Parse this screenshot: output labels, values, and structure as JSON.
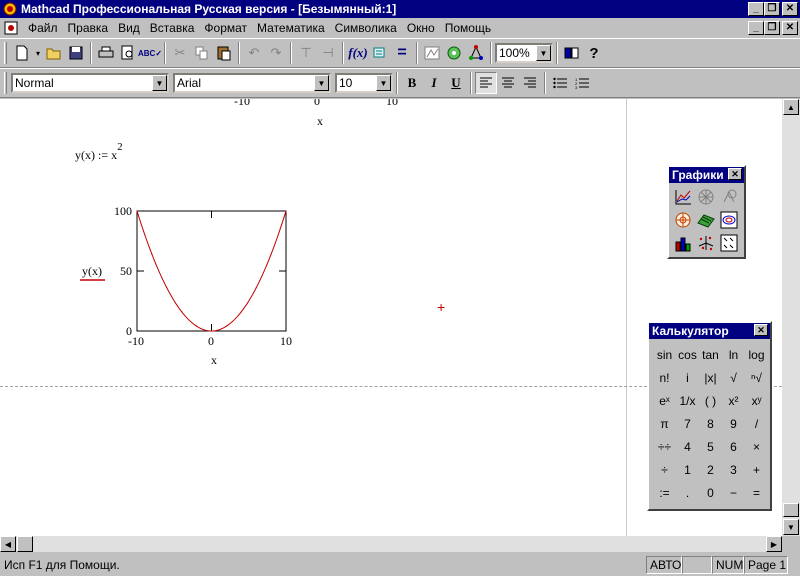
{
  "window": {
    "title": "Mathcad Профессиональная Русская версия - [Безымянный:1]"
  },
  "menu": [
    "Файл",
    "Правка",
    "Вид",
    "Вставка",
    "Формат",
    "Математика",
    "Символика",
    "Окно",
    "Помощь"
  ],
  "toolbar": {
    "zoom": "100%"
  },
  "format_toolbar": {
    "style": "Normal",
    "font": "Arial",
    "size": "10",
    "bold": "B",
    "italic": "I",
    "underline": "U"
  },
  "worksheet": {
    "top_ticks": [
      "-10",
      "0",
      "10"
    ],
    "top_xlabel": "x",
    "definition": "y(x) := x",
    "definition_exp": "2",
    "cursor_glyph": "+"
  },
  "chart_data": {
    "type": "line",
    "series": [
      {
        "function": "y(x) = x^2",
        "x": [
          -10,
          -8,
          -6,
          -4,
          -2,
          0,
          2,
          4,
          6,
          8,
          10
        ],
        "y": [
          100,
          64,
          36,
          16,
          4,
          0,
          4,
          16,
          36,
          64,
          100
        ],
        "color": "#c00000"
      }
    ],
    "xlim": [
      -10,
      10
    ],
    "ylim": [
      0,
      100
    ],
    "x_ticks": [
      "-10",
      "0",
      "10"
    ],
    "y_ticks": [
      "0",
      "50",
      "100"
    ],
    "xlabel": "x",
    "ylabel": "y(x)",
    "grid": false
  },
  "graph_palette": {
    "title": "Графики",
    "icons": [
      "xy-plot-icon",
      "polar-plot-icon",
      "zoom-icon",
      "polar-target-icon",
      "surface-plot-icon",
      "contour-plot-icon",
      "bar-3d-icon",
      "scatter-3d-icon",
      "vector-field-icon"
    ]
  },
  "calc_palette": {
    "title": "Калькулятор",
    "keys": [
      "sin",
      "cos",
      "tan",
      "ln",
      "log",
      "n!",
      "i",
      "|x|",
      "√",
      "ⁿ√",
      "eˣ",
      "1/x",
      "( )",
      "x²",
      "xʸ",
      "π",
      "7",
      "8",
      "9",
      "/",
      "÷÷",
      "4",
      "5",
      "6",
      "×",
      "÷",
      "1",
      "2",
      "3",
      "+",
      ":=",
      ".",
      "0",
      "−",
      "="
    ]
  },
  "statusbar": {
    "help": "Исп F1 для Помощи.",
    "mode": "АВТО",
    "num": "NUM",
    "page": "Page 1"
  }
}
